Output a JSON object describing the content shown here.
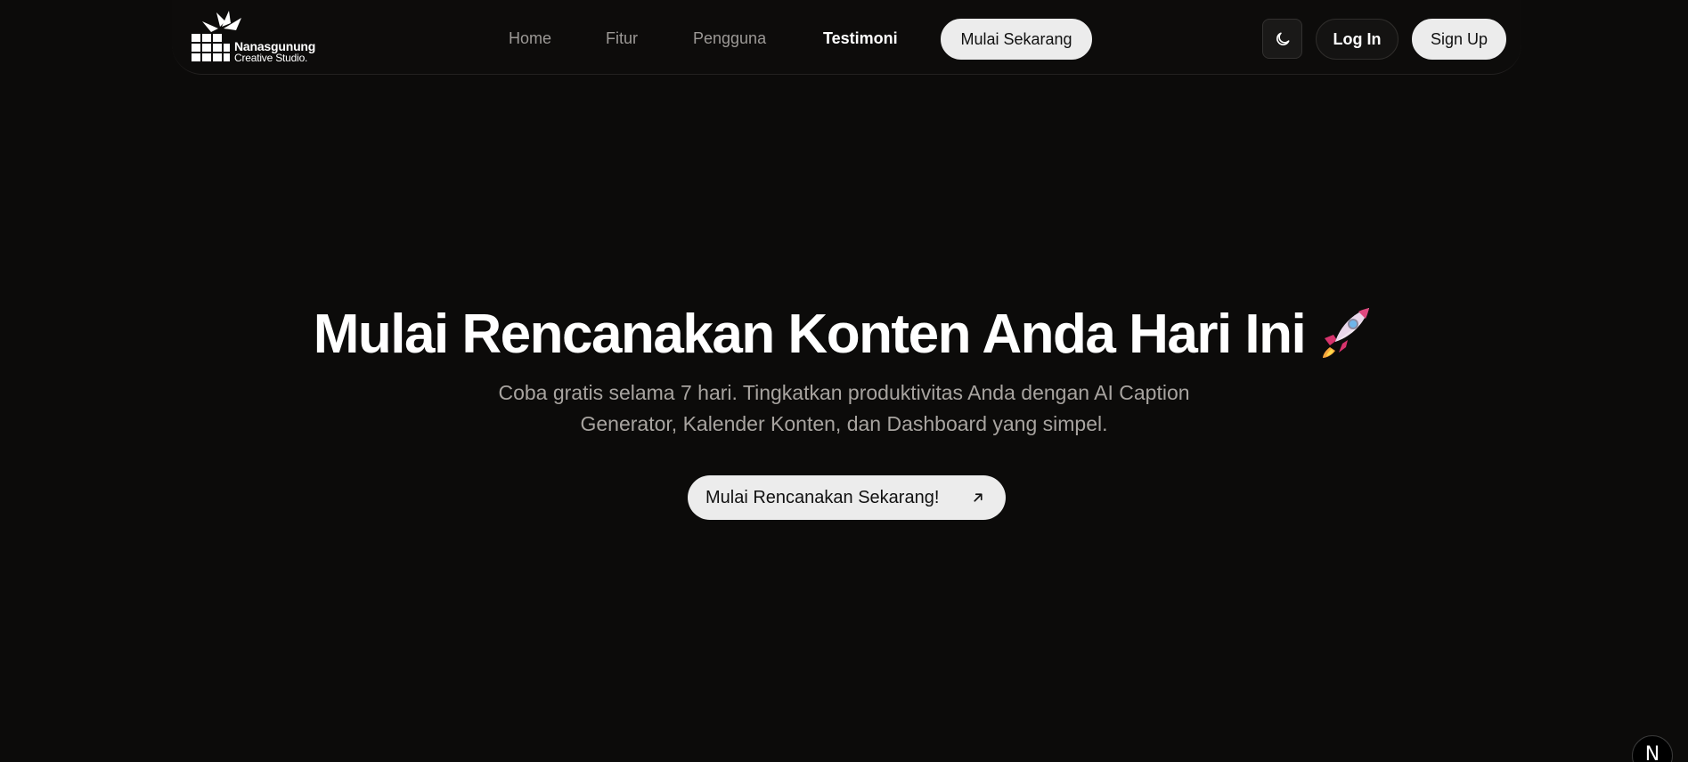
{
  "brand": {
    "name": "Nanasgunung",
    "subtitle": "Creative Studio."
  },
  "nav": {
    "links": [
      {
        "label": "Home",
        "active": false
      },
      {
        "label": "Fitur",
        "active": false
      },
      {
        "label": "Pengguna",
        "active": false
      },
      {
        "label": "Testimoni",
        "active": true
      }
    ],
    "cta_label": "Mulai Sekarang",
    "theme_icon": "moon-icon",
    "login_label": "Log In",
    "signup_label": "Sign Up"
  },
  "hero": {
    "title": "Mulai Rencanakan Konten Anda Hari Ini",
    "title_emoji": "rocket-icon",
    "subtitle_line1": "Coba gratis selama 7 hari. Tingkatkan produktivitas Anda dengan AI Caption",
    "subtitle_line2": "Generator, Kalender Konten, dan Dashboard yang simpel.",
    "cta_label": "Mulai Rencanakan Sekarang!",
    "cta_icon": "arrow-up-right-icon"
  },
  "dev_badge": {
    "letter": "N",
    "icon": "nextjs-icon"
  },
  "colors": {
    "background": "#0c0b0a",
    "button_light": "#ececec",
    "text_muted": "#9c9996",
    "text_primary": "#ffffff"
  }
}
